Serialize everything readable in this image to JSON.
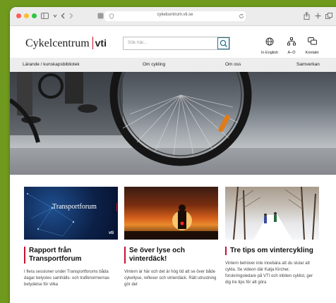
{
  "browser": {
    "url": "cykelcentrum.vti.se"
  },
  "site": {
    "logo_text": "Cykelcentrum",
    "logo_vti": "vti",
    "search_placeholder": "Sök här...",
    "header_icons": [
      {
        "icon": "globe-icon",
        "label": "In English"
      },
      {
        "icon": "sitemap-icon",
        "label": "A–Ö"
      },
      {
        "icon": "chat-icon",
        "label": "Kontakt"
      }
    ],
    "nav": [
      "Lärande / kunskapsbibliotek",
      "Om cykling",
      "Om oss",
      "Samverkan"
    ]
  },
  "cards": [
    {
      "title": "Rapport från Transportforum",
      "image_text": "Transportforum",
      "image_logo": "vti",
      "text": "I flera sessioner under Transportforums båda dagar belystes samhälls- och trafiknormernas betydelse för vilka"
    },
    {
      "title": "Se över lyse och vinterdäck!",
      "text": "Vintern är här och det är hög tid att se över både cykellyse, reflexer och vinterdäck. Rätt utrustning gör det"
    },
    {
      "title": "Tre tips om vintercykling",
      "text": "Vintern behöver inte innebära att du slutar att cykla. Se videon där Katja Kircher, forskningsledare på VTI och inbiten cyklist, ger dig tre tips för att göra"
    }
  ]
}
